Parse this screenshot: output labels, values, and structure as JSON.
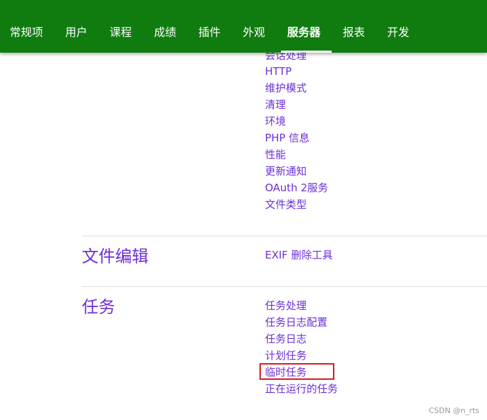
{
  "nav": {
    "items": [
      "常规项",
      "用户",
      "课程",
      "成绩",
      "插件",
      "外观",
      "服务器",
      "报表",
      "开发"
    ],
    "active": "服务器",
    "bar_color": "#107c10"
  },
  "server_section": {
    "partial_link": "会话处理",
    "links": [
      "HTTP",
      "维护模式",
      "清理",
      "环境",
      "PHP 信息",
      "性能",
      "更新通知",
      "OAuth 2服务",
      "文件类型"
    ]
  },
  "file_edit_section": {
    "title": "文件编辑",
    "links": [
      "EXIF 删除工具"
    ]
  },
  "task_section": {
    "title": "任务",
    "links": [
      "任务处理",
      "任务日志配置",
      "任务日志",
      "计划任务",
      "临时任务",
      "正在运行的任务"
    ],
    "highlighted": "临时任务",
    "highlight_color": "#d7191c"
  },
  "link_color": "#6c2fd6",
  "watermark": "CSDN @n_rts"
}
